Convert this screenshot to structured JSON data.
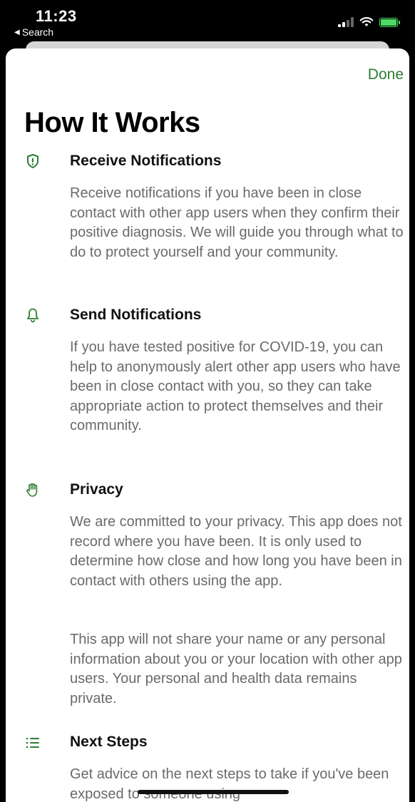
{
  "status_bar": {
    "time": "11:23",
    "back_label": "Search",
    "back_icon": "back-triangle-icon"
  },
  "header": {
    "done_label": "Done",
    "title": "How It Works"
  },
  "sections": [
    {
      "icon": "alert-shield-icon",
      "heading": "Receive Notifications",
      "body": "Receive notifications if you have been in close contact with other app users when they confirm their positive diagnosis. We will guide you through what to do to protect yourself and your community."
    },
    {
      "icon": "bell-icon",
      "heading": "Send Notifications",
      "body": "If you have tested positive for COVID-19, you can help to anonymously alert other app users who have been in close contact with you, so they can take appropriate action to protect themselves and their community."
    },
    {
      "icon": "hand-icon",
      "heading": "Privacy",
      "body": "We are committed to your privacy. This app does not record where you have been. It is only used to determine how close and how long you have been in contact with others using the app.",
      "body2": "This app will not share your name or any personal information about you or your location with other app users. Your personal and health data remains private."
    },
    {
      "icon": "list-icon",
      "heading": "Next Steps",
      "body": "Get advice on the next steps to take if you've been exposed to someone using"
    }
  ],
  "colors": {
    "accent": "#2e7d32",
    "body_text": "#6a6a6a",
    "battery": "#4cd964"
  }
}
